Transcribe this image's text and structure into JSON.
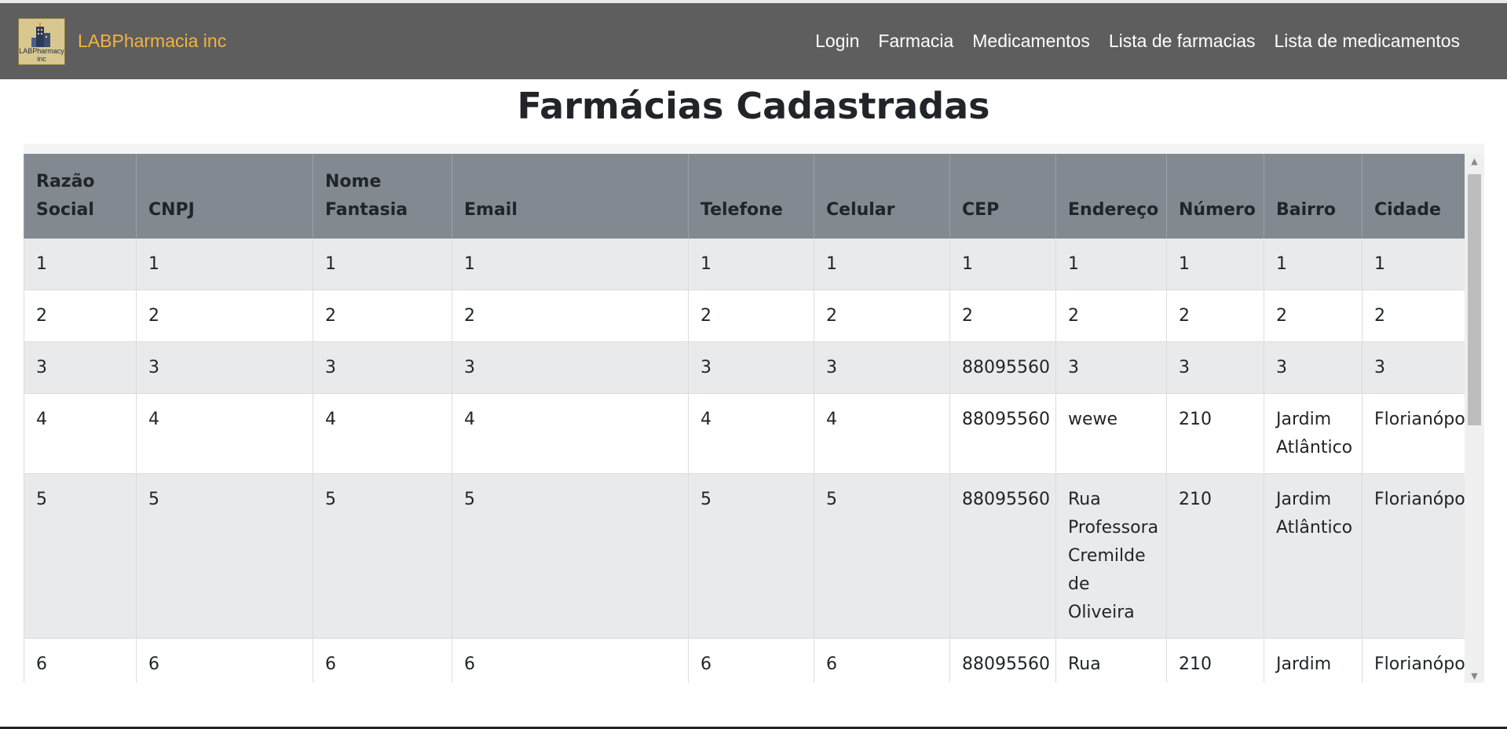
{
  "navbar": {
    "logo_text_line1": "LABPharmacy",
    "logo_text_line2": "inc",
    "brand": "LABPharmacia inc",
    "links": [
      "Login",
      "Farmacia",
      "Medicamentos",
      "Lista de farmacias",
      "Lista de medicamentos"
    ],
    "background": "#5e5e5e",
    "brand_color": "#f3b33e"
  },
  "page_title": "Farmácias Cadastradas",
  "table": {
    "headers": [
      "Razão Social",
      "CNPJ",
      "Nome Fantasia",
      "Email",
      "Telefone",
      "Celular",
      "CEP",
      "Endereço",
      "Número",
      "Bairro",
      "Cidade"
    ],
    "rows": [
      [
        "1",
        "1",
        "1",
        "1",
        "1",
        "1",
        "1",
        "1",
        "1",
        "1",
        "1"
      ],
      [
        "2",
        "2",
        "2",
        "2",
        "2",
        "2",
        "2",
        "2",
        "2",
        "2",
        "2"
      ],
      [
        "3",
        "3",
        "3",
        "3",
        "3",
        "3",
        "88095560",
        "3",
        "3",
        "3",
        "3"
      ],
      [
        "4",
        "4",
        "4",
        "4",
        "4",
        "4",
        "88095560",
        "wewe",
        "210",
        "Jardim Atlântico",
        "Florianópolis"
      ],
      [
        "5",
        "5",
        "5",
        "5",
        "5",
        "5",
        "88095560",
        "Rua Professora Cremilde de Oliveira",
        "210",
        "Jardim Atlântico",
        "Florianópolis"
      ],
      [
        "6",
        "6",
        "6",
        "6",
        "6",
        "6",
        "88095560",
        "Rua",
        "210",
        "Jardim",
        "Florianópolis"
      ]
    ],
    "header_background": "#828990",
    "striped_row_background": "#e9eaeb"
  },
  "scrollbar": {
    "up_arrow": "▲",
    "down_arrow": "▼"
  }
}
